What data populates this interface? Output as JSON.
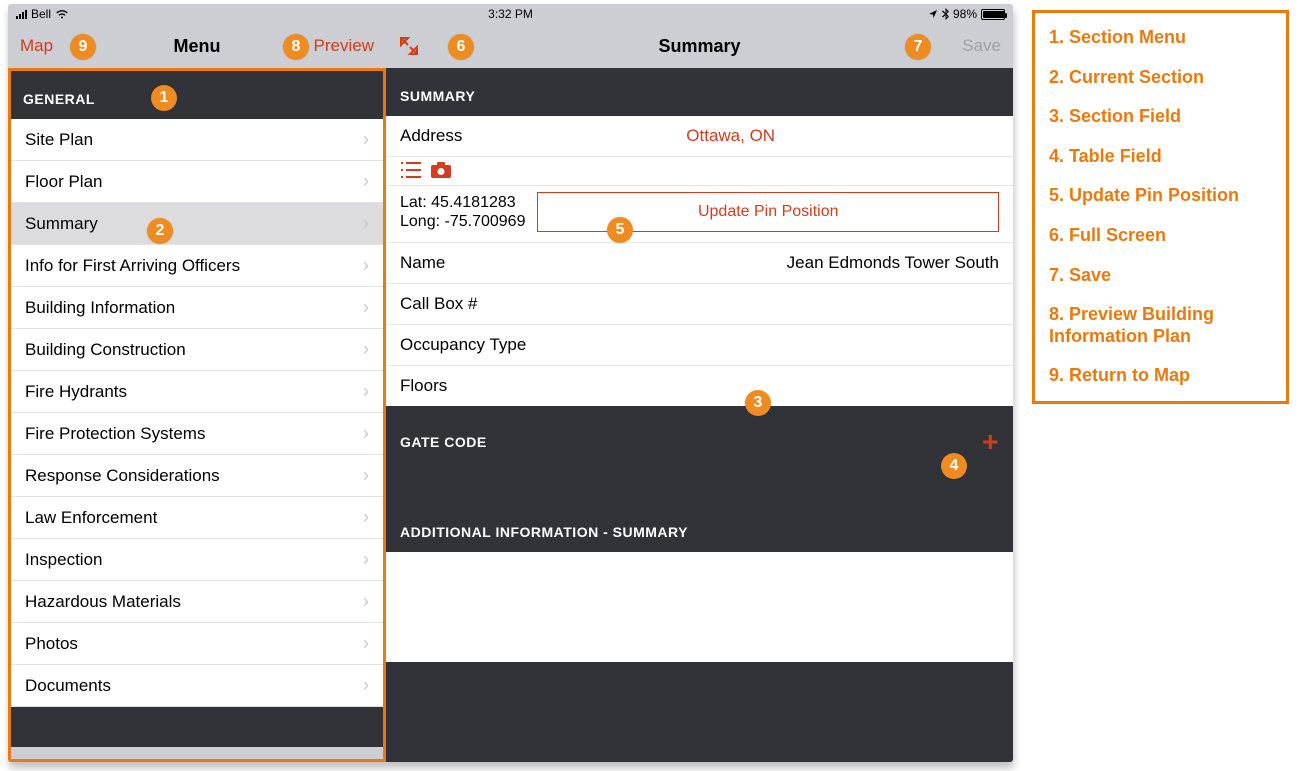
{
  "status": {
    "carrier": "Bell",
    "time": "3:32 PM",
    "battery_pct": "98%"
  },
  "left_nav": {
    "map_btn": "Map",
    "title": "Menu",
    "preview_btn": "Preview"
  },
  "right_nav": {
    "title": "Summary",
    "save_btn": "Save"
  },
  "menu": {
    "header": "GENERAL",
    "items": [
      {
        "label": "Site Plan"
      },
      {
        "label": "Floor Plan"
      },
      {
        "label": "Summary",
        "selected": true
      },
      {
        "label": "Info for First Arriving Officers"
      },
      {
        "label": "Building Information"
      },
      {
        "label": "Building Construction"
      },
      {
        "label": "Fire Hydrants"
      },
      {
        "label": "Fire Protection Systems"
      },
      {
        "label": "Response Considerations"
      },
      {
        "label": "Law Enforcement"
      },
      {
        "label": "Inspection"
      },
      {
        "label": "Hazardous Materials"
      },
      {
        "label": "Photos"
      },
      {
        "label": "Documents"
      }
    ]
  },
  "summary": {
    "header": "SUMMARY",
    "address_label": "Address",
    "address_value": "Ottawa, ON",
    "lat_label": "Lat:",
    "lat_value": "45.4181283",
    "long_label": "Long:",
    "long_value": "-75.700969",
    "update_pin_btn": "Update Pin Position",
    "name_label": "Name",
    "name_value": "Jean Edmonds Tower South",
    "callbox_label": "Call Box #",
    "callbox_value": "",
    "occupancy_label": "Occupancy Type",
    "occupancy_value": "",
    "floors_label": "Floors",
    "floors_value": "",
    "gatecode_header": "GATE CODE",
    "addl_header": "ADDITIONAL INFORMATION - SUMMARY"
  },
  "callouts": {
    "1": "1",
    "2": "2",
    "3": "3",
    "4": "4",
    "5": "5",
    "6": "6",
    "7": "7",
    "8": "8",
    "9": "9"
  },
  "legend": [
    "1. Section Menu",
    "2. Current Section",
    "3. Section Field",
    "4. Table Field",
    "5. Update Pin Position",
    "6. Full Screen",
    "7. Save",
    "8. Preview Building Information Plan",
    "9. Return to Map"
  ]
}
